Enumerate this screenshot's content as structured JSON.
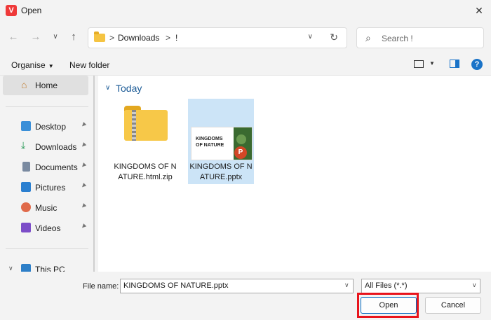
{
  "titlebar": {
    "title": "Open",
    "app_logo_letter": "V",
    "close_glyph": "✕"
  },
  "navbar": {
    "back": "←",
    "forward": "→",
    "history": "∨",
    "up": "↑",
    "breadcrumb": [
      "Downloads",
      "!"
    ],
    "breadcrumb_sep": ">",
    "dropdown_glyph": "∨",
    "refresh_glyph": "↻",
    "search_placeholder": "Search !"
  },
  "cmdbar": {
    "organise": "Organise",
    "new_folder": "New folder",
    "caret": "▼",
    "help": "?"
  },
  "sidebar": {
    "home": "Home",
    "items": [
      {
        "label": "Desktop",
        "icon": "desktop-icon",
        "color": "#3a8fd8"
      },
      {
        "label": "Downloads",
        "icon": "download-icon",
        "color": "#2e9b5b"
      },
      {
        "label": "Documents",
        "icon": "document-icon",
        "color": "#7a8aa0"
      },
      {
        "label": "Pictures",
        "icon": "pictures-icon",
        "color": "#2a7fd0"
      },
      {
        "label": "Music",
        "icon": "music-icon",
        "color": "#e06a4a"
      },
      {
        "label": "Videos",
        "icon": "videos-icon",
        "color": "#7c4dc8"
      }
    ],
    "this_pc": "This PC",
    "pin": "📌"
  },
  "content": {
    "group_title": "Today",
    "group_caret": "∨",
    "files": [
      {
        "name": "KINGDOMS OF NATURE.html.zip",
        "type": "zip-folder",
        "selected": false
      },
      {
        "name": "KINGDOMS OF NATURE.pptx",
        "type": "pptx",
        "selected": true,
        "thumb_text": "KINGDOMS\nOF NATURE",
        "badge": "P"
      }
    ]
  },
  "bottom": {
    "file_name_label": "File name:",
    "file_name_value": "KINGDOMS OF NATURE.pptx",
    "file_type": "All Files (*.*)",
    "open": "Open",
    "cancel": "Cancel",
    "caret": "∨"
  },
  "colors": {
    "accent": "#0067c0",
    "highlight": "#e8141c",
    "selection": "#cce4f7"
  }
}
